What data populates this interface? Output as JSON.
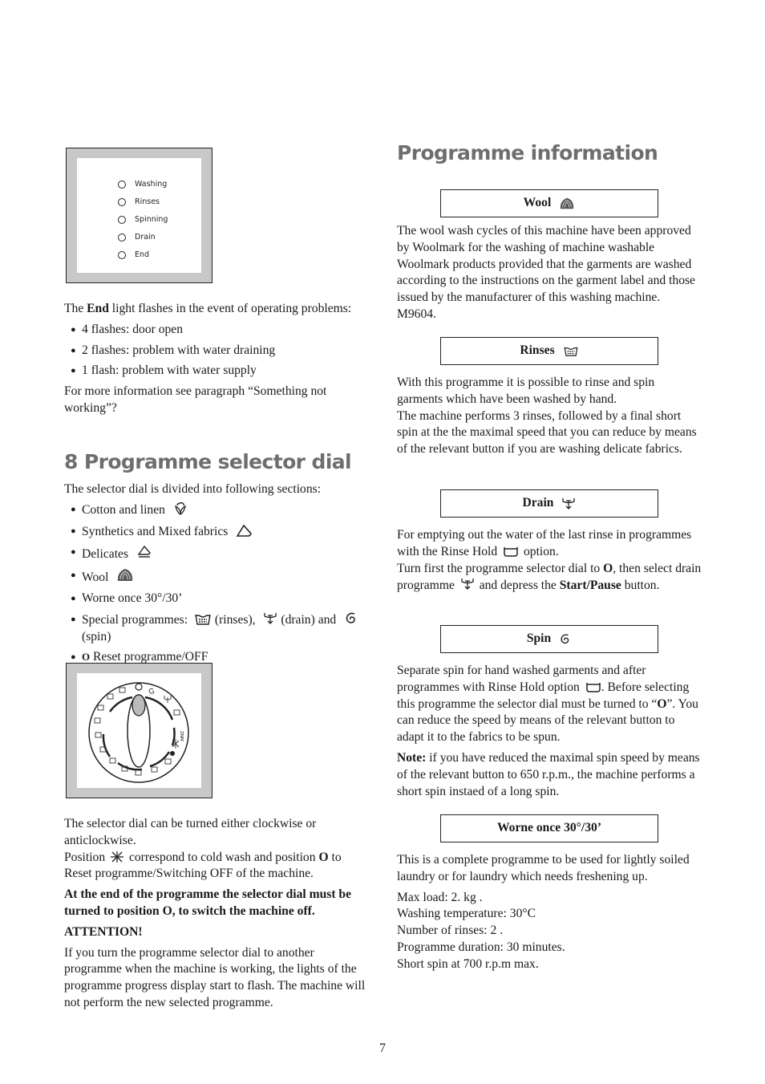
{
  "left": {
    "progress_panel": {
      "lights": [
        "Washing",
        "Rinses",
        "Spinning",
        "Drain",
        "End"
      ]
    },
    "end_intro": {
      "pre": "The ",
      "bold": "End",
      "post": " light flashes in the event of operating problems:"
    },
    "end_flashes": [
      "4 flashes: door open",
      "2 flashes: problem with water draining",
      "1 flash: problem with water supply"
    ],
    "more_info": "For more information see paragraph “Something not working”?",
    "section_heading": "8 Programme selector dial",
    "selector_intro": "The selector dial is divided into following sections:",
    "sections": {
      "cotton": {
        "label": "Cotton and linen",
        "icon": "cotton-icon"
      },
      "synthetics": {
        "label": "Synthetics and Mixed fabrics",
        "icon": "synthetics-icon"
      },
      "delicates": {
        "label": "Delicates",
        "icon": "delicates-icon"
      },
      "wool": {
        "label": "Wool",
        "icon": "wool-icon"
      },
      "worne": {
        "label": "Worne once 30°/30’"
      },
      "special": {
        "label": "Special programmes:",
        "rinses": "(rinses),",
        "drain": "(drain) and",
        "spin": "(spin)"
      },
      "reset": {
        "bold": "O",
        "label": "Reset programme/OFF"
      }
    },
    "dial_text_1": "The selector dial can be turned either clockwise or anticlockwise.",
    "dial_text_2": {
      "pre": "Position",
      "mid": "correspond to cold wash and position",
      "bold": "O",
      "post": "to Reset programme/Switching OFF of the machine."
    },
    "end_warning": "At the end of the programme the selector dial must be turned to position O, to switch the machine off.",
    "attention": "ATTENTION!",
    "attention_text": "If you turn the programme selector dial to another programme when the machine is working, the lights of the programme progress display start to flash. The machine will not perform the new selected programme."
  },
  "right": {
    "heading": "Programme information",
    "wool": {
      "title": "Wool",
      "text": "The wool wash cycles of this machine have been approved by Woolmark for the washing of machine washable Woolmark products provided that the garments are washed according to the instructions on the garment label and those issued by the manufacturer of this washing machine. M9604."
    },
    "rinses": {
      "title": "Rinses",
      "text1": "With this programme it is possible to rinse and spin garments which have been washed by hand.",
      "text2": "The machine performs 3 rinses, followed by a final short spin at the the maximal speed that you can reduce by means of the relevant button if you are washing delicate fabrics."
    },
    "drain": {
      "title": "Drain",
      "text1_pre": "For emptying out the water of the last rinse in programmes with the Rinse Hold",
      "text1_post": "option.",
      "text2_pre": "Turn first the programme selector dial to",
      "text2_bold1": "O",
      "text2_mid": ", then select drain programme",
      "text2_mid2": "and depress the",
      "text2_bold2": "Start/Pause",
      "text2_post": "button."
    },
    "spin": {
      "title": "Spin",
      "text_pre": "Separate spin for hand washed garments and after programmes with Rinse Hold option",
      "text_mid": ". Before selecting this programme the selector dial must be turned to “",
      "text_bold": "O",
      "text_post": "”. You can reduce the speed by means of the relevant button to adapt it to the fabrics to be spun.",
      "note_bold": "Note:",
      "note_text": " if you have reduced the maximal spin speed by means of the relevant button to 650 r.p.m., the machine performs a short spin instaed of a long spin."
    },
    "worne": {
      "title": "Worne once 30°/30’",
      "text": "This is a complete programme to be used for lightly soiled laundry or for laundry which needs freshening up.",
      "specs": [
        "Max load: 2. kg .",
        "Washing temperature: 30°C",
        "Number of rinses: 2 .",
        "Programme duration: 30 minutes.",
        "Short spin at 700 r.p.m max."
      ]
    }
  },
  "page_number": "7"
}
